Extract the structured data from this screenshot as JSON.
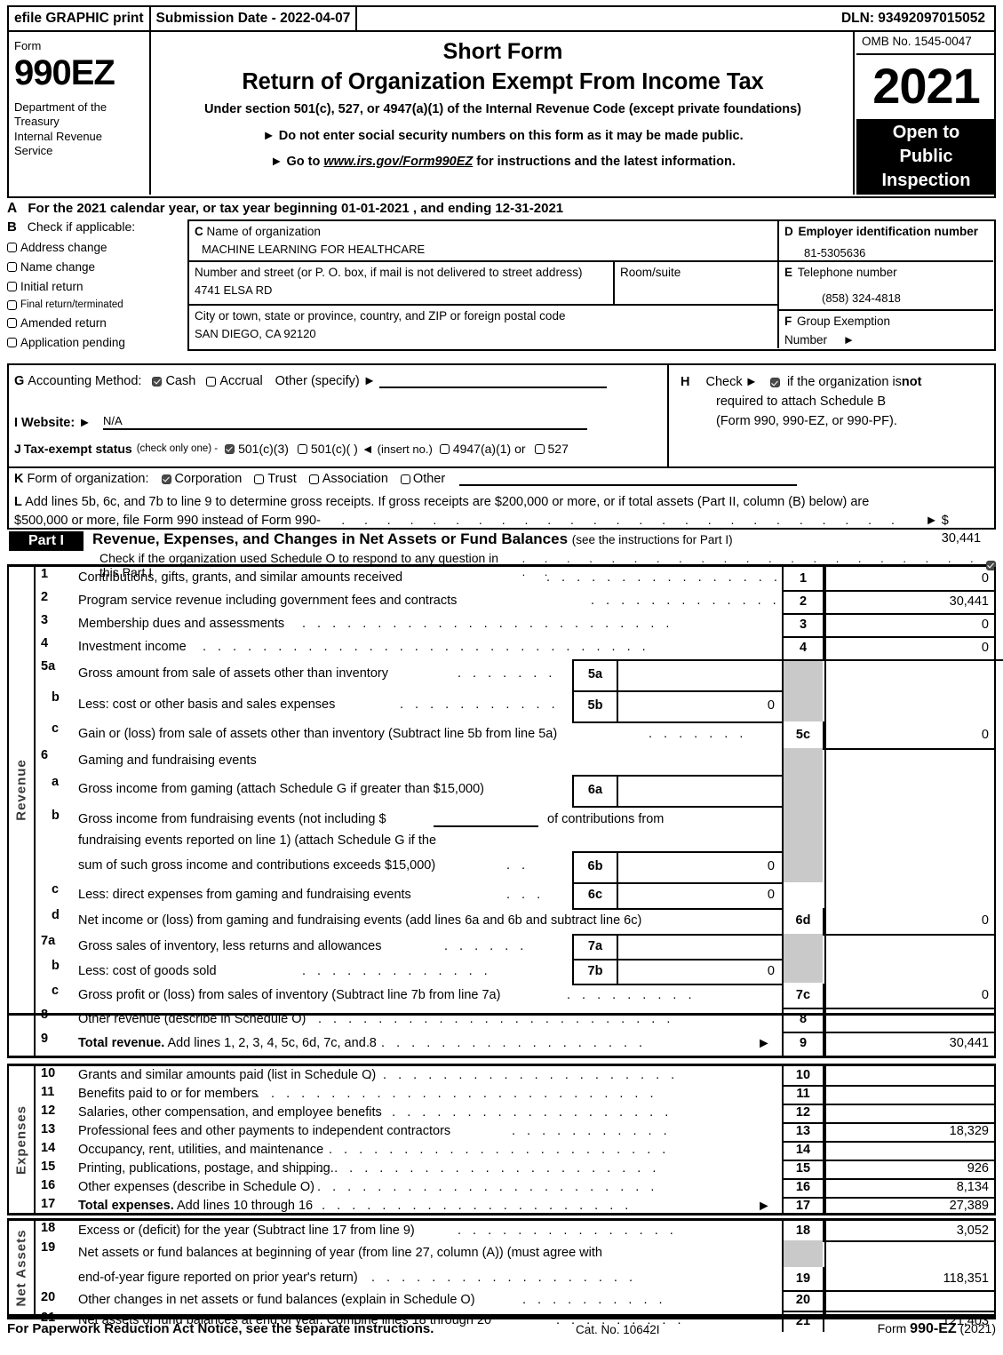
{
  "efile_bar": {
    "graphic_print": "efile GRAPHIC print",
    "submission_date": "Submission Date - 2022-04-07",
    "dln": "DLN: 93492097015052"
  },
  "masthead": {
    "form_word": "Form",
    "form_number": "990EZ",
    "department": "Department of the Treasury Internal Revenue Service",
    "title_short": "Short Form",
    "title_main": "Return of Organization Exempt From Income Tax",
    "subtitle": "Under section 501(c), 527, or 4947(a)(1) of the Internal Revenue Code (except private foundations)",
    "bullet_1": "Do not enter social security numbers on this form as it may be made public.",
    "bullet_2_pre": "Go to ",
    "bullet_2_link": "www.irs.gov/Form990EZ",
    "bullet_2_post": " for instructions and the latest information.",
    "omb": "OMB No. 1545-0047",
    "year": "2021",
    "open_to": "Open to",
    "public": "Public",
    "inspection": "Inspection"
  },
  "section_a": {
    "letter": "A",
    "text": "For the 2021 calendar year, or tax year beginning 01-01-2021 , and ending 12-31-2021"
  },
  "section_b": {
    "letter": "B",
    "heading": "Check if applicable:",
    "items": [
      {
        "label": "Address change",
        "checked": false,
        "small": false
      },
      {
        "label": "Name change",
        "checked": false,
        "small": false
      },
      {
        "label": "Initial return",
        "checked": false,
        "small": false
      },
      {
        "label": "Final return/terminated",
        "checked": false,
        "small": true
      },
      {
        "label": "Amended return",
        "checked": false,
        "small": false
      },
      {
        "label": "Application pending",
        "checked": false,
        "small": false
      }
    ]
  },
  "section_c": {
    "letter": "C",
    "name_label": "Name of organization",
    "name_value": "MACHINE LEARNING FOR HEALTHCARE",
    "street_label": "Number and street (or P. O. box, if mail is not delivered to street address)",
    "street_value": "4741 ELSA RD",
    "room_label": "Room/suite",
    "room_value": "",
    "city_label": "City or town, state or province, country, and ZIP or foreign postal code",
    "city_value": "SAN DIEGO, CA  92120"
  },
  "section_d": {
    "letter": "D",
    "label": "Employer identification number",
    "value": "81-5305636"
  },
  "section_e": {
    "letter": "E",
    "label": "Telephone number",
    "value": "(858) 324-4818"
  },
  "section_f": {
    "letter": "F",
    "label": "Group Exemption",
    "label2": "Number",
    "value": ""
  },
  "section_g": {
    "letter": "G",
    "label": "Accounting Method:",
    "cash": "Cash",
    "cash_checked": true,
    "accrual": "Accrual",
    "accrual_checked": false,
    "other": "Other (specify)",
    "other_value": ""
  },
  "section_h": {
    "letter": "H",
    "line1_pre": "Check",
    "line1_post_a": "if the organization is ",
    "line1_post_b": "not",
    "checked": true,
    "line2": "required to attach Schedule B",
    "line3": "(Form 990, 990-EZ, or 990-PF)."
  },
  "section_i": {
    "letter": "I",
    "label": "Website:",
    "value": "N/A"
  },
  "section_j": {
    "letter": "J",
    "label": "Tax-exempt status",
    "note": "(check only one) -",
    "options": [
      {
        "label": "501(c)(3)",
        "checked": true
      },
      {
        "label": "501(c)(   )",
        "checked": false
      },
      {
        "label": "4947(a)(1) or",
        "checked": false
      },
      {
        "label": "527",
        "checked": false
      }
    ],
    "insert_no": "(insert no.)"
  },
  "section_k": {
    "letter": "K",
    "label": "Form of organization:",
    "options": [
      {
        "label": "Corporation",
        "checked": true
      },
      {
        "label": "Trust",
        "checked": false
      },
      {
        "label": "Association",
        "checked": false
      },
      {
        "label": "Other",
        "checked": false
      }
    ]
  },
  "section_l": {
    "letter": "L",
    "line1": "Add lines 5b, 6c, and 7b to line 9 to determine gross receipts. If gross receipts are $200,000 or more, or if total assets (Part II, column (B) below) are",
    "line2": "$500,000 or more, file Form 990 instead of Form 990-EZ",
    "amount": "$ 30,441"
  },
  "part_i": {
    "tag": "Part I",
    "title": "Revenue, Expenses, and Changes in Net Assets or Fund Balances",
    "title_note": "(see the instructions for Part I)",
    "subtext": "Check if the organization used Schedule O to respond to any question in this Part I",
    "sub_checked": true
  },
  "side_labels": {
    "revenue": "Revenue",
    "expenses": "Expenses",
    "net_assets": "Net Assets"
  },
  "revenue_rows": [
    {
      "num": "1",
      "text": "Contributions, gifts, grants, and similar amounts received",
      "box": "1",
      "value": "0"
    },
    {
      "num": "2",
      "text": "Program service revenue including government fees and contracts",
      "box": "2",
      "value": "30,441"
    },
    {
      "num": "3",
      "text": "Membership dues and assessments",
      "box": "3",
      "value": "0"
    },
    {
      "num": "4",
      "text": "Investment income",
      "box": "4",
      "value": "0"
    },
    {
      "num": "5a",
      "text": "Gross amount from sale of assets other than inventory",
      "inner_box": "5a",
      "inner_value": ""
    },
    {
      "num": "b",
      "text": "Less: cost or other basis and sales expenses",
      "inner_box": "5b",
      "inner_value": "0"
    },
    {
      "num": "c",
      "text": "Gain or (loss) from sale of assets other than inventory (Subtract line 5b from line 5a)",
      "box": "5c",
      "value": "0"
    },
    {
      "num": "6",
      "text": "Gaming and fundraising events",
      "box": "",
      "value": ""
    },
    {
      "num": "a",
      "text": "Gross income from gaming (attach Schedule G if greater than $15,000)",
      "inner_box": "6a",
      "inner_value": ""
    },
    {
      "num": "b",
      "text": "Gross income from fundraising events (not including $",
      "text2": "of contributions from",
      "box": "",
      "value": ""
    },
    {
      "num": "",
      "text": "fundraising events reported on line 1) (attach Schedule G if the",
      "box": "",
      "value": ""
    },
    {
      "num": "",
      "text": "sum of such gross income and contributions exceeds $15,000)",
      "inner_box": "6b",
      "inner_value": "0"
    },
    {
      "num": "c",
      "text": "Less: direct expenses from gaming and fundraising events",
      "inner_box": "6c",
      "inner_value": "0"
    },
    {
      "num": "d",
      "text": "Net income or (loss) from gaming and fundraising events (add lines 6a and 6b and subtract line 6c)",
      "box": "6d",
      "value": "0"
    },
    {
      "num": "7a",
      "text": "Gross sales of inventory, less returns and allowances",
      "inner_box": "7a",
      "inner_value": ""
    },
    {
      "num": "b",
      "text": "Less: cost of goods sold",
      "inner_box": "7b",
      "inner_value": "0"
    },
    {
      "num": "c",
      "text": "Gross profit or (loss) from sales of inventory (Subtract line 7b from line 7a)",
      "box": "7c",
      "value": "0"
    },
    {
      "num": "8",
      "text": "Other revenue (describe in Schedule O)",
      "box": "8",
      "value": ""
    },
    {
      "num": "9",
      "text_bold": "Total revenue.",
      "text": "Add lines 1, 2, 3, 4, 5c, 6d, 7c, and 8",
      "box": "9",
      "value": "30,441"
    }
  ],
  "expense_rows": [
    {
      "num": "10",
      "text": "Grants and similar amounts paid (list in Schedule O)",
      "box": "10",
      "value": ""
    },
    {
      "num": "11",
      "text": "Benefits paid to or for members",
      "box": "11",
      "value": ""
    },
    {
      "num": "12",
      "text": "Salaries, other compensation, and employee benefits",
      "box": "12",
      "value": ""
    },
    {
      "num": "13",
      "text": "Professional fees and other payments to independent contractors",
      "box": "13",
      "value": "18,329"
    },
    {
      "num": "14",
      "text": "Occupancy, rent, utilities, and maintenance",
      "box": "14",
      "value": ""
    },
    {
      "num": "15",
      "text": "Printing, publications, postage, and shipping.",
      "box": "15",
      "value": "926"
    },
    {
      "num": "16",
      "text": "Other expenses (describe in Schedule O)",
      "box": "16",
      "value": "8,134"
    },
    {
      "num": "17",
      "text_bold": "Total expenses.",
      "text": "Add lines 10 through 16",
      "box": "17",
      "value": "27,389"
    }
  ],
  "netasset_rows": [
    {
      "num": "18",
      "text": "Excess or (deficit) for the year (Subtract line 17 from line 9)",
      "box": "18",
      "value": "3,052"
    },
    {
      "num": "19",
      "text": "Net assets or fund balances at beginning of year (from line 27, column (A)) (must agree with",
      "box": "",
      "value": ""
    },
    {
      "num": "",
      "text": "end-of-year figure reported on prior year's return)",
      "box": "19",
      "value": "118,351"
    },
    {
      "num": "20",
      "text": "Other changes in net assets or fund balances (explain in Schedule O)",
      "box": "20",
      "value": ""
    },
    {
      "num": "21",
      "text": "Net assets or fund balances at end of year. Combine lines 18 through 20",
      "box": "21",
      "value": "121,403"
    }
  ],
  "footer": {
    "left": "For Paperwork Reduction Act Notice, see the separate instructions.",
    "center": "Cat. No. 10642I",
    "right_pre": "Form ",
    "right_num": "990-EZ",
    "right_post": " (2021)"
  }
}
